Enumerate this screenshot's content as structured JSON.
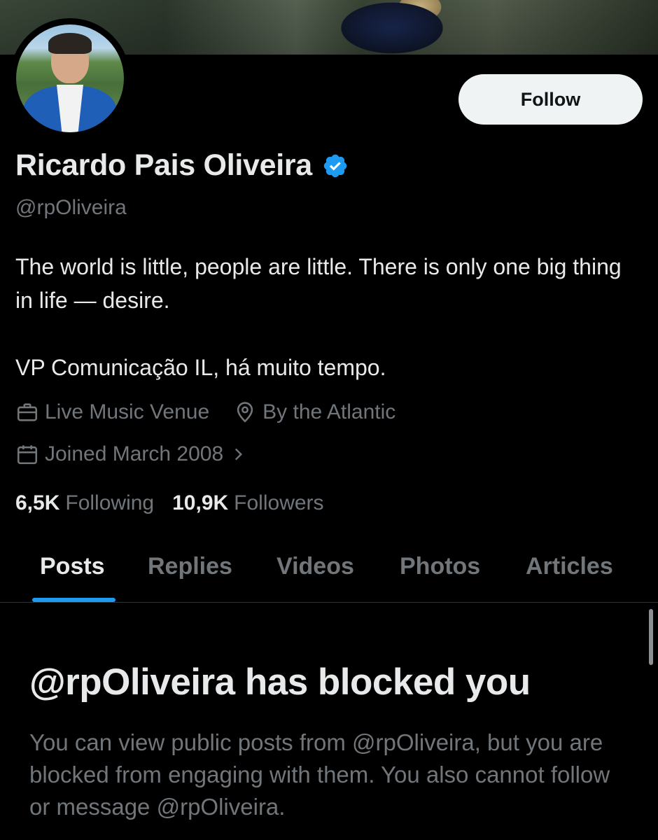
{
  "profile": {
    "name": "Ricardo Pais Oliveira",
    "handle": "@rpOliveira",
    "follow_label": "Follow",
    "bio_line1": "The world is little, people are little. There is only one big thing in life — desire.",
    "bio_line2": "VP Comunicação IL, há muito tempo.",
    "category": "Live Music Venue",
    "location": "By the Atlantic",
    "joined": "Joined March 2008",
    "following_count": "6,5K",
    "following_label": "Following",
    "followers_count": "10,9K",
    "followers_label": "Followers"
  },
  "tabs": [
    {
      "label": "Posts",
      "active": true
    },
    {
      "label": "Replies",
      "active": false
    },
    {
      "label": "Videos",
      "active": false
    },
    {
      "label": "Photos",
      "active": false
    },
    {
      "label": "Articles",
      "active": false
    }
  ],
  "blocked": {
    "title": "@rpOliveira has blocked you",
    "description": "You can view public posts from @rpOliveira, but you are blocked from engaging with them. You also cannot follow or message @rpOliveira."
  },
  "colors": {
    "background": "#000000",
    "primary_text": "#e7e9ea",
    "secondary_text": "#71767b",
    "accent": "#1d9bf0",
    "follow_button_bg": "#eff3f4"
  },
  "icons": [
    "verified-badge-icon",
    "briefcase-icon",
    "location-pin-icon",
    "calendar-icon",
    "chevron-right-icon"
  ]
}
